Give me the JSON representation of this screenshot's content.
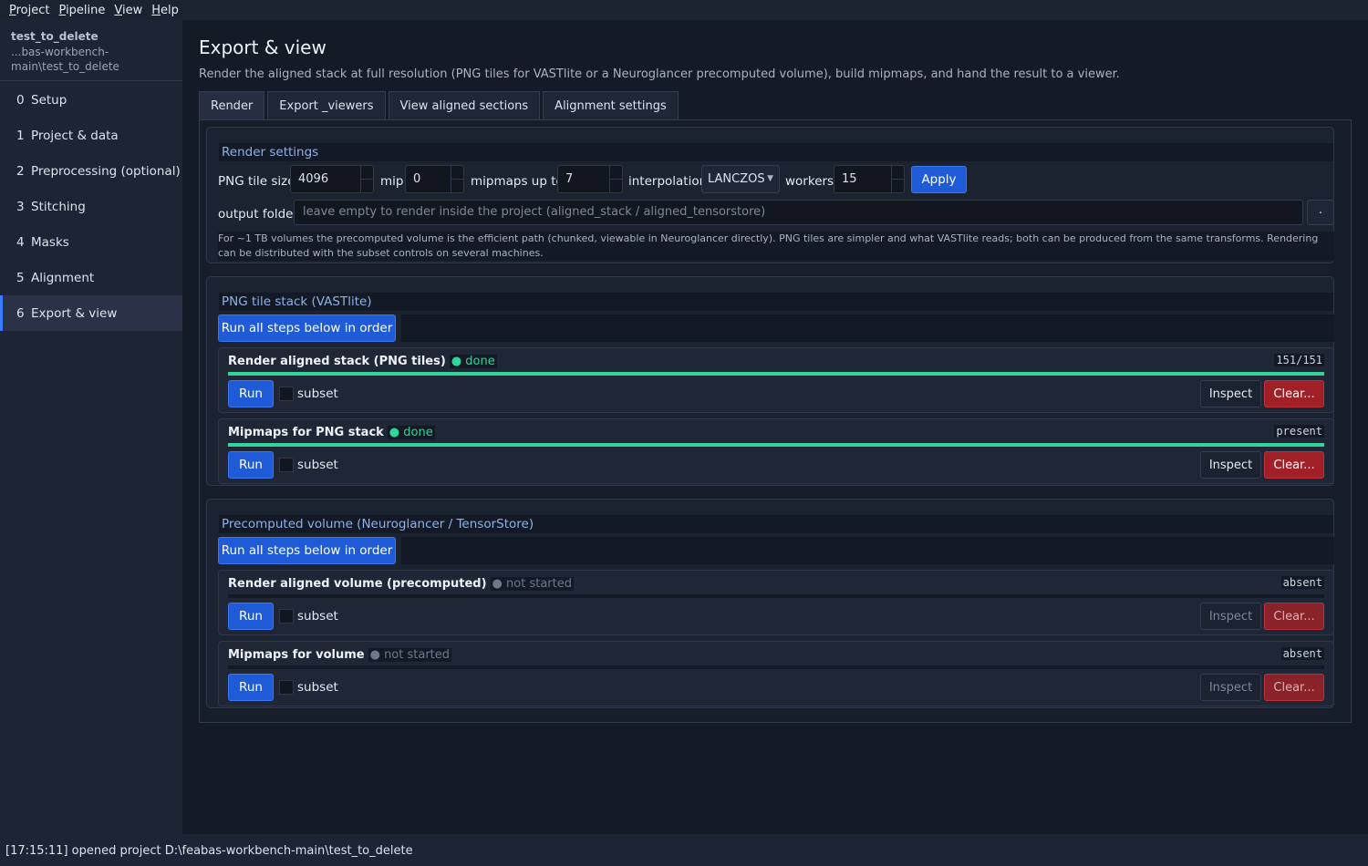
{
  "menu": [
    {
      "label": "Project",
      "ul": "P",
      "rest": "roject"
    },
    {
      "label": "Pipeline",
      "ul": "P",
      "rest": "ipeline"
    },
    {
      "label": "View",
      "ul": "V",
      "rest": "iew"
    },
    {
      "label": "Help",
      "ul": "H",
      "rest": "elp"
    }
  ],
  "sidebar": {
    "project_name": "test_to_delete",
    "project_path_line1": "...bas-workbench-",
    "project_path_line2": "main\\test_to_delete",
    "items": [
      {
        "num": "0",
        "label": "Setup"
      },
      {
        "num": "1",
        "label": "Project & data"
      },
      {
        "num": "2",
        "label": "Preprocessing (optional)"
      },
      {
        "num": "3",
        "label": "Stitching"
      },
      {
        "num": "4",
        "label": "Masks"
      },
      {
        "num": "5",
        "label": "Alignment"
      },
      {
        "num": "6",
        "label": "Export & view"
      }
    ],
    "active_index": 6
  },
  "page": {
    "title": "Export & view",
    "description": "Render the aligned stack at full resolution (PNG tiles for VASTlite or a Neuroglancer precomputed volume), build mipmaps, and hand the result to a viewer."
  },
  "tabs": [
    "Render",
    "Export _viewers",
    "View aligned sections",
    "Alignment settings"
  ],
  "render_settings": {
    "title": "Render settings",
    "png_tile_size_label": "PNG tile size",
    "png_tile_size": "4096",
    "mip_label": "mip",
    "mip": "0",
    "mipmaps_label": "mipmaps up to",
    "mipmaps": "7",
    "interpolation_label": "interpolation",
    "interpolation": "LANCZOS",
    "workers_label": "workers",
    "workers": "15",
    "apply_label": "Apply",
    "output_folder_label": "output folder",
    "output_folder_placeholder": "leave empty to render inside the project (aligned_stack / aligned_tensorstore)",
    "browse_label": ".",
    "note": "For ~1 TB volumes the precomputed volume is the efficient path (chunked, viewable in Neuroglancer directly). PNG tiles are simpler and what VASTlite reads; both can be produced from the same transforms. Rendering can be distributed with the subset controls on several machines."
  },
  "png_group": {
    "title": "PNG tile stack (VASTlite)",
    "run_all_label": "Run all steps below in order",
    "steps": [
      {
        "title": "Render aligned stack (PNG tiles)",
        "status": "● done",
        "meta": "151/151",
        "progress": 1.0,
        "run": "Run",
        "subset": "subset",
        "inspect": "Inspect",
        "clear": "Clear..."
      },
      {
        "title": "Mipmaps for PNG stack",
        "status": "● done",
        "meta": "present",
        "progress": 1.0,
        "run": "Run",
        "subset": "subset",
        "inspect": "Inspect",
        "clear": "Clear..."
      }
    ]
  },
  "volume_group": {
    "title": "Precomputed volume (Neuroglancer / TensorStore)",
    "run_all_label": "Run all steps below in order",
    "steps": [
      {
        "title": "Render aligned volume (precomputed)",
        "status": "● not started",
        "meta": "absent",
        "progress": 0.0,
        "run": "Run",
        "subset": "subset",
        "inspect": "Inspect",
        "clear": "Clear..."
      },
      {
        "title": "Mipmaps for volume",
        "status": "● not started",
        "meta": "absent",
        "progress": 0.0,
        "run": "Run",
        "subset": "subset",
        "inspect": "Inspect",
        "clear": "Clear..."
      }
    ]
  },
  "statusbar": {
    "text": "[17:15:11] opened project D:\\feabas-workbench-main\\test_to_delete"
  },
  "colors": {
    "accent": "#1f5bd6",
    "done": "#34d399",
    "danger": "#a11f26"
  }
}
